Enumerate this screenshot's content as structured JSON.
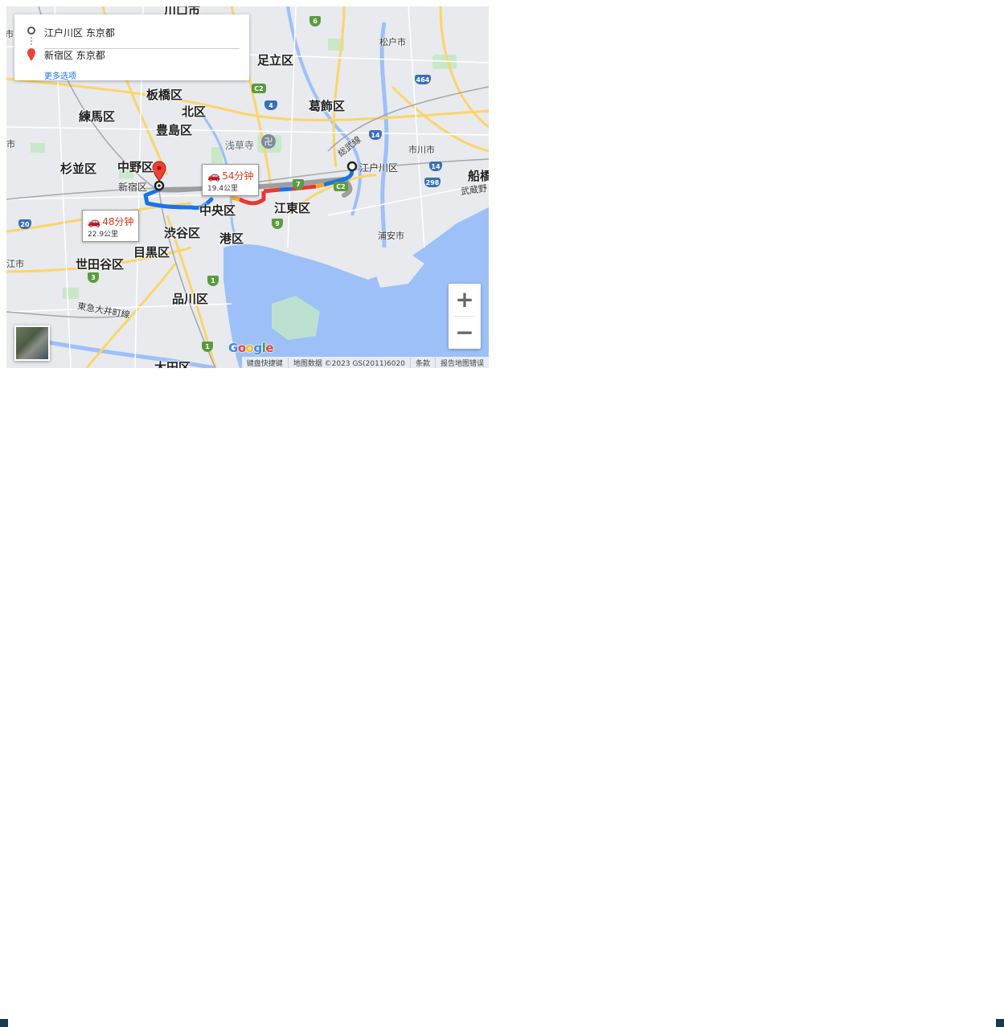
{
  "directions": {
    "origin": "江户川区 东京都",
    "destination": "新宿区 东京都",
    "more_options": "更多选项"
  },
  "routes": [
    {
      "time": "54分钟",
      "distance": "19.4公里"
    },
    {
      "time": "48分钟",
      "distance": "22.9公里"
    }
  ],
  "labels": {
    "kawaguchi": "川口市",
    "adachi": "足立区",
    "matsudo": "松户市",
    "itabashi": "板橋区",
    "kita": "北区",
    "katsushika": "葛飾区",
    "nerima": "練馬区",
    "toshima": "豊島区",
    "sensoji": "浅草寺",
    "sobu": "総武線",
    "ichikawa": "市川市",
    "suginami": "杉並区",
    "nakano": "中野区",
    "shinjuku": "新宿区",
    "edogawa": "江户川区",
    "funabashi": "船橋",
    "musashino": "武蔵野",
    "chuo": "中央区",
    "koto": "江東区",
    "shibuya": "渋谷区",
    "minato": "港区",
    "urayasu": "浦安市",
    "setagaya": "世田谷区",
    "meguro": "目黒区",
    "shinagawa": "品川区",
    "tokyu": "東急大井町線",
    "ota": "大田区",
    "edge_left1": "市",
    "edge_left2": "市",
    "edge_left3": "江市"
  },
  "shields": {
    "r6": "6",
    "r464": "464",
    "c2a": "C2",
    "r4": "4",
    "r14": "14",
    "r298": "298",
    "r7": "7",
    "c2b": "C2",
    "r9": "9",
    "r20": "20",
    "r3": "3",
    "r1a": "1",
    "r1b": "1"
  },
  "controls": {
    "zoom_in": "+",
    "zoom_out": "−"
  },
  "attribution": {
    "shortcuts": "键盘快捷键",
    "map_data": "地图数据 ©2023 GS(2011)6020",
    "terms": "条款",
    "report": "报告地图错误"
  },
  "logo": "Google",
  "colors": {
    "water": "#9dc0f8",
    "route_blue": "#1a73e8",
    "route_alt": "#9e9e9e",
    "traffic_red": "#e53935",
    "traffic_orange": "#f9a825"
  }
}
